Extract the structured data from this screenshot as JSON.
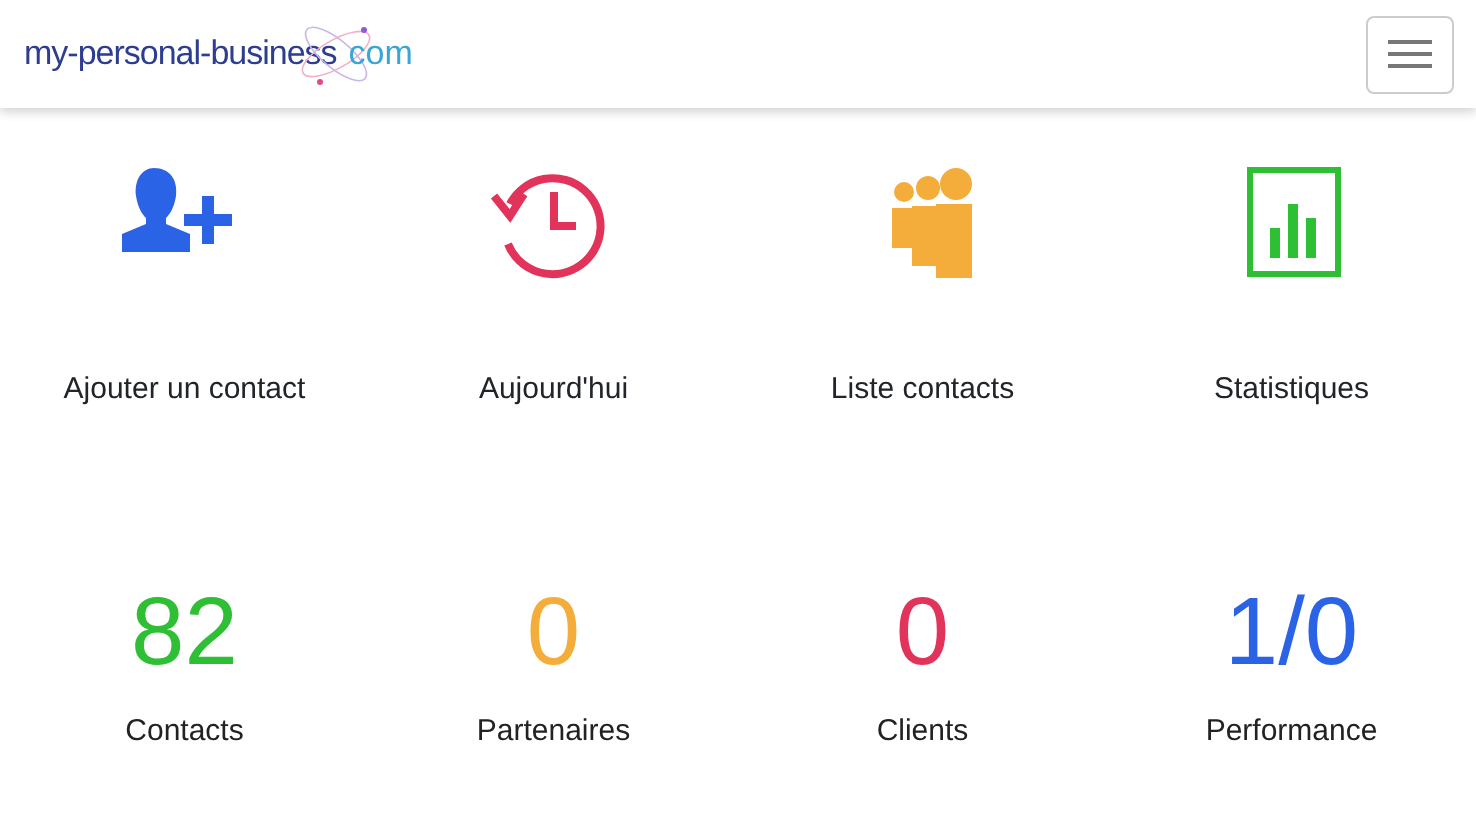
{
  "navbar": {
    "logo": {
      "main": "my-personal-business",
      "tld": "com"
    },
    "menu_toggle": {
      "expanded": false
    }
  },
  "shortcuts": [
    {
      "kind": "add-user",
      "label": "Ajouter un contact",
      "color": "#2b63e6"
    },
    {
      "kind": "history",
      "label": "Aujourd'hui",
      "color": "#e2345a"
    },
    {
      "kind": "group",
      "label": "Liste contacts",
      "color": "#f4ad3a"
    },
    {
      "kind": "chart",
      "label": "Statistiques",
      "color": "#2fbf35"
    }
  ],
  "stats": [
    {
      "value": "82",
      "label": "Contacts",
      "color": "#2fbf35"
    },
    {
      "value": "0",
      "label": "Partenaires",
      "color": "#f4ad3a"
    },
    {
      "value": "0",
      "label": "Clients",
      "color": "#e2345a"
    },
    {
      "value": "1/0",
      "label": "Performance",
      "color": "#2b63e6"
    }
  ]
}
